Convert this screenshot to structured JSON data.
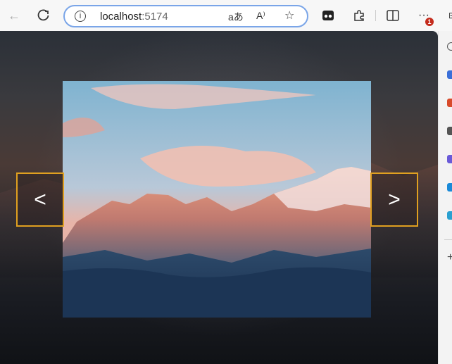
{
  "browser": {
    "address": {
      "host": "localhost",
      "port": ":5174"
    },
    "notification_count": "1"
  },
  "carousel": {
    "prev_label": "<",
    "next_label": ">",
    "image_subject": "mountain range at sunset"
  },
  "colors": {
    "nav_border": "#e0a020",
    "address_border": "#7aa5e8"
  }
}
